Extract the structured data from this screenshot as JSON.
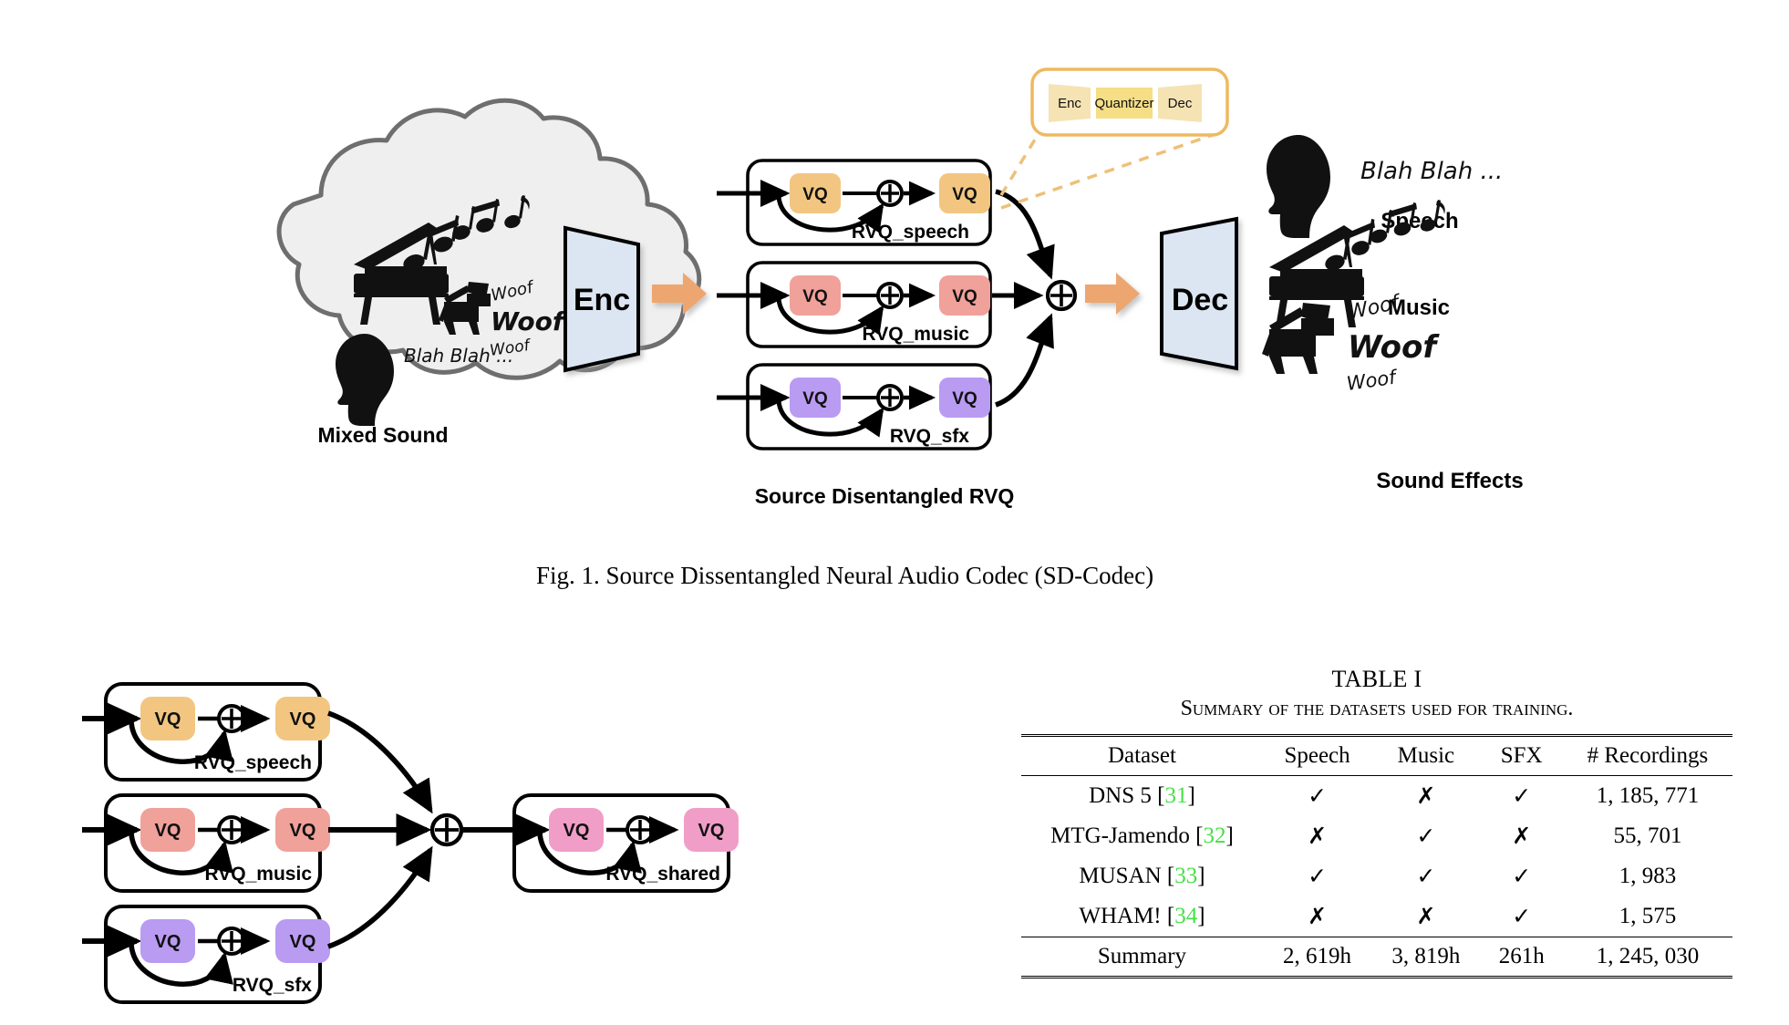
{
  "figure": {
    "caption": "Fig. 1.   Source Dissentangled Neural Audio Codec (SD-Codec)",
    "mixed_sound_label": "Mixed Sound",
    "source_disentangled_label": "Source Disentangled RVQ",
    "encoder_label": "Enc",
    "decoder_label": "Dec",
    "cloud": {
      "speech_text": "Blah Blah ...",
      "woof_small_top": "Woof",
      "woof_big": "Woof",
      "woof_small_bottom": "Woof"
    },
    "inset": {
      "enc": "Enc",
      "quantizer": "Quantizer",
      "dec": "Dec"
    },
    "rvq_rows": [
      {
        "name": "RVQ_speech",
        "color": "#f2c680",
        "vq_label": "VQ",
        "plus": "⊕"
      },
      {
        "name": "RVQ_music",
        "color": "#f0a19a",
        "vq_label": "VQ",
        "plus": "⊕"
      },
      {
        "name": "RVQ_sfx",
        "color": "#b99bf2",
        "vq_label": "VQ",
        "plus": "⊕"
      }
    ],
    "outputs": [
      {
        "label": "Speech",
        "text": "Blah Blah ..."
      },
      {
        "label": "Music",
        "text": ""
      },
      {
        "label": "Sound Effects",
        "text": "Woof"
      }
    ]
  },
  "figure2": {
    "rvq_rows": [
      {
        "name": "RVQ_speech",
        "color": "#f2c680",
        "vq_label": "VQ",
        "plus": "⊕"
      },
      {
        "name": "RVQ_music",
        "color": "#f0a19a",
        "vq_label": "VQ",
        "plus": "⊕"
      },
      {
        "name": "RVQ_sfx",
        "color": "#b99bf2",
        "vq_label": "VQ",
        "plus": "⊕"
      }
    ],
    "shared": {
      "name": "RVQ_shared",
      "color": "#f09ec7",
      "vq_label": "VQ",
      "plus": "⊕"
    }
  },
  "table": {
    "number": "TABLE I",
    "title": "Summary of the datasets used for training.",
    "columns": [
      "Dataset",
      "Speech",
      "Music",
      "SFX",
      "# Recordings"
    ],
    "rows": [
      {
        "dataset": "DNS 5",
        "ref": "31",
        "speech": "✓",
        "music": "✗",
        "sfx": "✓",
        "recordings": "1, 185, 771"
      },
      {
        "dataset": "MTG-Jamendo",
        "ref": "32",
        "speech": "✗",
        "music": "✓",
        "sfx": "✗",
        "recordings": "55, 701"
      },
      {
        "dataset": "MUSAN",
        "ref": "33",
        "speech": "✓",
        "music": "✓",
        "sfx": "✓",
        "recordings": "1, 983"
      },
      {
        "dataset": "WHAM!",
        "ref": "34",
        "speech": "✗",
        "music": "✗",
        "sfx": "✓",
        "recordings": "1, 575"
      }
    ],
    "summary": {
      "dataset": "Summary",
      "speech": "2, 619h",
      "music": "3, 819h",
      "sfx": "261h",
      "recordings": "1, 245, 030"
    },
    "ref_color": "#46e046"
  }
}
